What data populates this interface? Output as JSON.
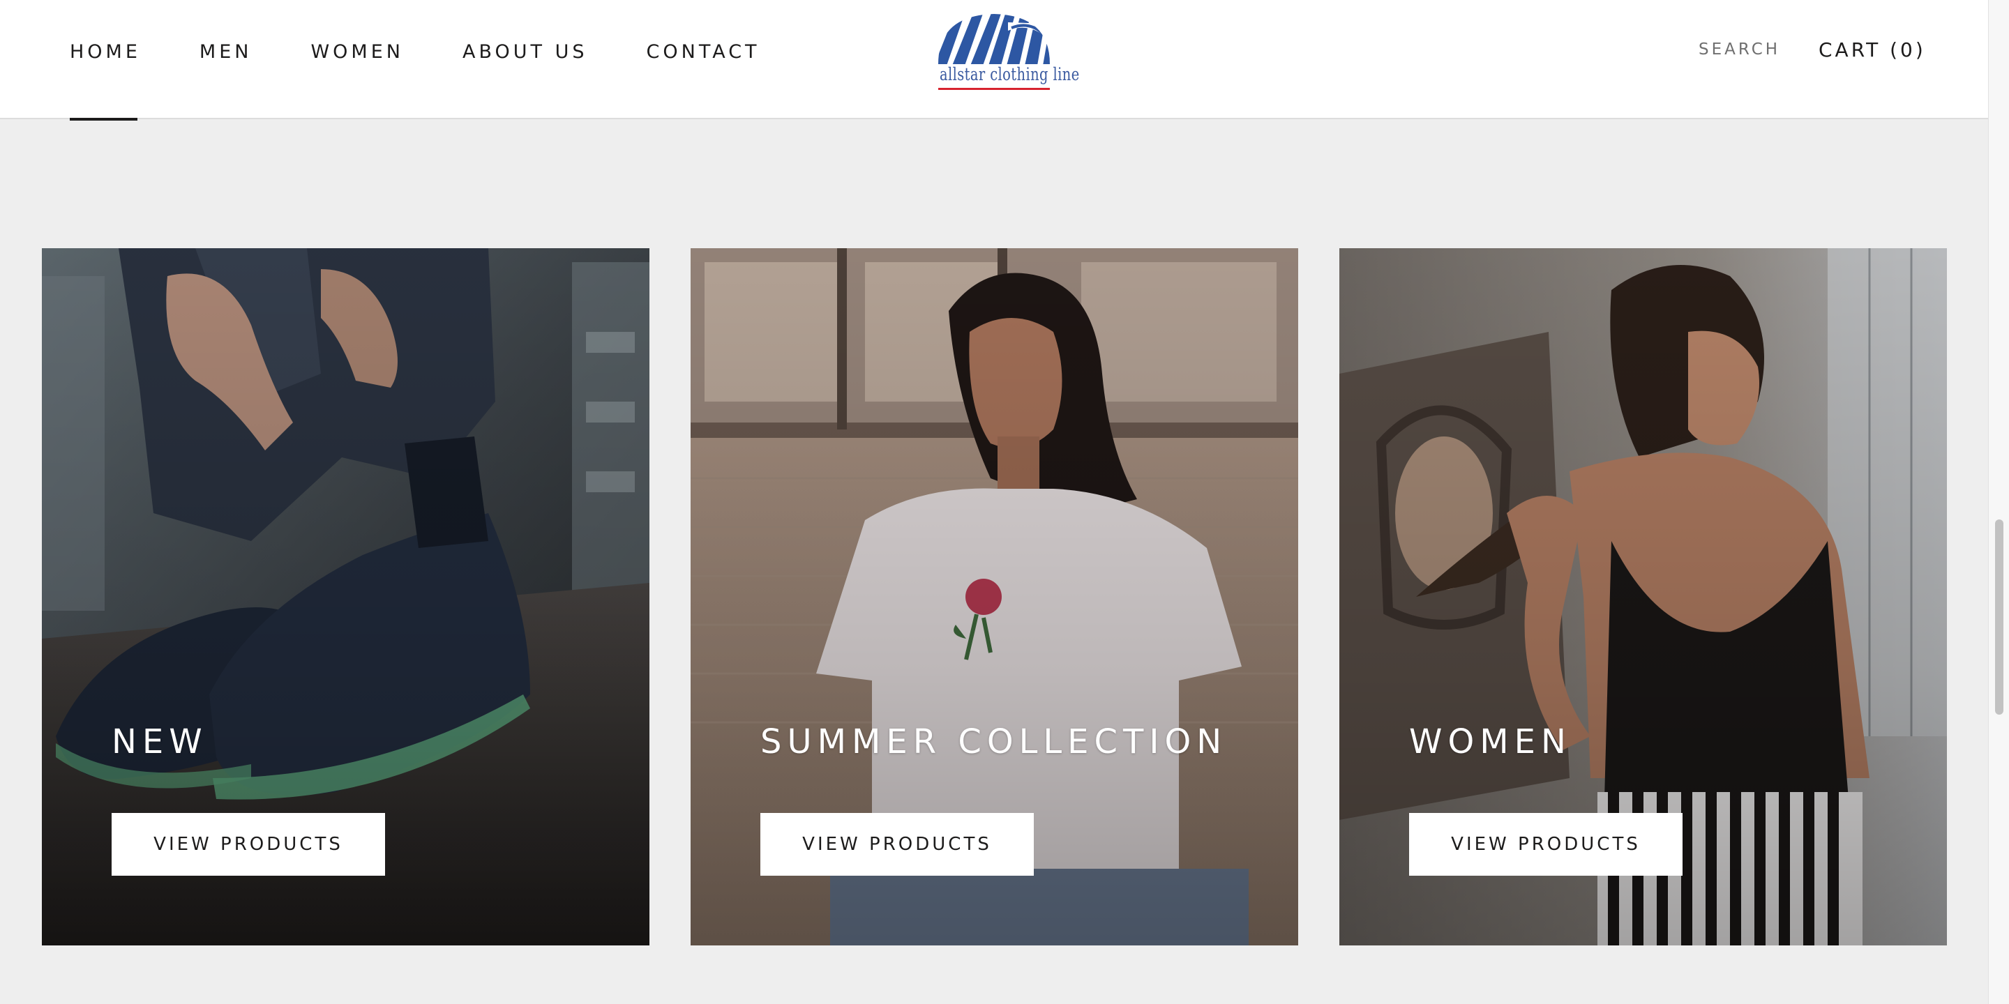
{
  "header": {
    "nav": [
      {
        "label": "HOME",
        "active": true
      },
      {
        "label": "MEN",
        "active": false
      },
      {
        "label": "WOMEN",
        "active": false
      },
      {
        "label": "ABOUT US",
        "active": false
      },
      {
        "label": "CONTACT",
        "active": false
      }
    ],
    "logo": {
      "text": "allstar clothing line",
      "colors": {
        "blue": "#2d57a3",
        "red": "#d7232e"
      }
    },
    "search_label": "SEARCH",
    "cart_label": "CART (0)"
  },
  "collections": [
    {
      "title": "NEW",
      "button_label": "VIEW PRODUCTS",
      "image": "sneakers-photo"
    },
    {
      "title": "SUMMER COLLECTION",
      "button_label": "VIEW PRODUCTS",
      "image": "woman-rose-tshirt-photo"
    },
    {
      "title": "WOMEN",
      "button_label": "VIEW PRODUCTS",
      "image": "woman-black-top-photo"
    }
  ],
  "colors": {
    "page_bg": "#eeeeee",
    "header_bg": "#ffffff",
    "text": "#1c1b1b"
  }
}
